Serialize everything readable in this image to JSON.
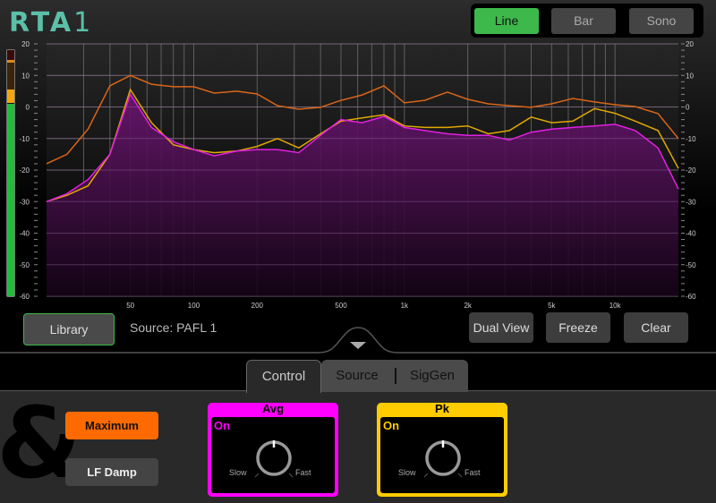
{
  "app": {
    "title_main": "RTA",
    "title_num": "1"
  },
  "modes": [
    {
      "label": "Line",
      "active": true
    },
    {
      "label": "Bar",
      "active": false
    },
    {
      "label": "Sono",
      "active": false
    }
  ],
  "meter": {
    "level_db": 0,
    "peak_hold_db": 13
  },
  "toolbar": {
    "library_label": "Library",
    "source_text": "Source: PAFL 1",
    "dual_view_label": "Dual View",
    "freeze_label": "Freeze",
    "clear_label": "Clear"
  },
  "tabs": [
    {
      "label": "Control",
      "active": true
    },
    {
      "label": "Source",
      "active": false
    },
    {
      "label": "SigGen",
      "active": false
    }
  ],
  "controls": {
    "maximum_label": "Maximum",
    "lf_damp_label": "LF Damp",
    "avg": {
      "title": "Avg",
      "state": "On",
      "slow": "Slow",
      "fast": "Fast",
      "color": "#ff00ff"
    },
    "pk": {
      "title": "Pk",
      "state": "On",
      "slow": "Slow",
      "fast": "Fast",
      "color": "#ffcc00"
    }
  },
  "colors": {
    "max_line": "#d9651a",
    "peak_line": "#e0a800",
    "avg_line": "#e020e0",
    "avg_fill": "#5a0f5e",
    "accent_green": "#3cb94a",
    "accent_orange": "#ff6a00"
  },
  "chart_data": {
    "type": "area",
    "xscale": "log",
    "xlim": [
      20,
      20000
    ],
    "ylim": [
      -60,
      20
    ],
    "x_ticks": [
      {
        "v": 50,
        "label": "50"
      },
      {
        "v": 100,
        "label": "100"
      },
      {
        "v": 200,
        "label": "200"
      },
      {
        "v": 500,
        "label": "500"
      },
      {
        "v": 1000,
        "label": "1k"
      },
      {
        "v": 2000,
        "label": "2k"
      },
      {
        "v": 5000,
        "label": "5k"
      },
      {
        "v": 10000,
        "label": "10k"
      }
    ],
    "y_ticks": [
      20,
      10,
      0,
      -10,
      -20,
      -30,
      -40,
      -50,
      -60
    ],
    "grid": true,
    "x": [
      20,
      25,
      31.5,
      40,
      50,
      63,
      80,
      100,
      125,
      160,
      200,
      250,
      315,
      400,
      500,
      630,
      800,
      1000,
      1250,
      1600,
      2000,
      2500,
      3150,
      4000,
      5000,
      6300,
      8000,
      10000,
      12500,
      16000,
      20000
    ],
    "series": [
      {
        "name": "Max",
        "values": [
          -18,
          -15,
          -7,
          6.7,
          10,
          7.2,
          6.4,
          6.4,
          4.4,
          5,
          4.1,
          0.4,
          -0.7,
          -0.1,
          2.1,
          3.8,
          6.7,
          1.3,
          2.1,
          4.7,
          2.4,
          1,
          0.4,
          -0.1,
          1,
          2.7,
          1.6,
          0.7,
          0.1,
          -2.1,
          -10
        ]
      },
      {
        "name": "Pk",
        "values": [
          -30,
          -28,
          -25,
          -15,
          5.5,
          -5,
          -12,
          -13.5,
          -14.5,
          -14,
          -12.5,
          -10,
          -13,
          -8.5,
          -4.5,
          -3.5,
          -2.5,
          -6,
          -6.5,
          -6.5,
          -6,
          -8.5,
          -7.5,
          -3.2,
          -5,
          -4.5,
          -0.5,
          -2,
          -4.5,
          -7.5,
          -19.5
        ]
      },
      {
        "name": "Avg",
        "values": [
          -30,
          -27.5,
          -23,
          -15,
          4,
          -6.5,
          -11,
          -13.5,
          -15.5,
          -14,
          -13.5,
          -13.5,
          -14.5,
          -9,
          -4,
          -5,
          -3,
          -6.5,
          -7.5,
          -8.5,
          -9,
          -9,
          -10.5,
          -8,
          -7,
          -6.5,
          -6,
          -5.5,
          -7.5,
          -13,
          -26
        ]
      }
    ]
  }
}
